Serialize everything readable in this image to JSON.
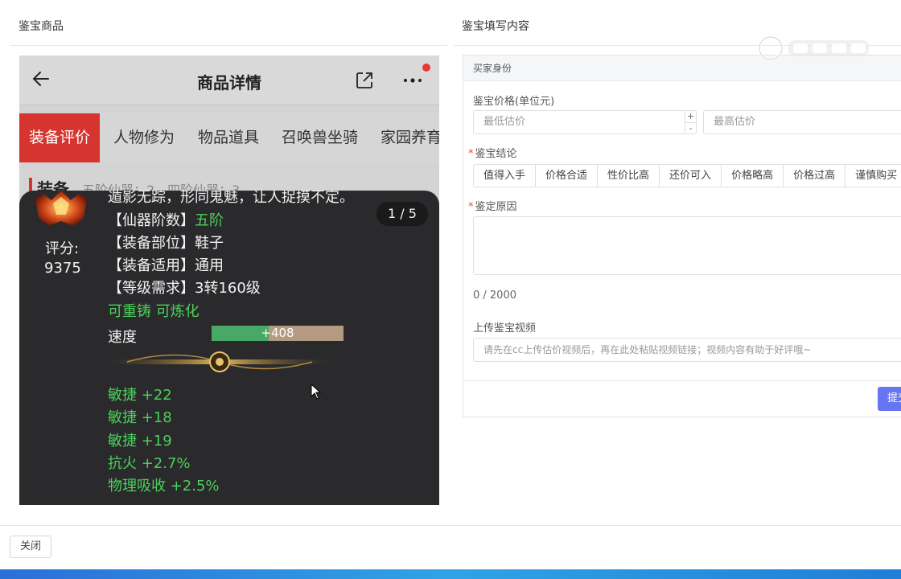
{
  "left_section": {
    "title": "鉴宝商品"
  },
  "right_section": {
    "title": "鉴宝填写内容"
  },
  "phone": {
    "header_title": "商品详情",
    "tabs": [
      "装备评价",
      "人物修为",
      "物品道具",
      "召唤兽坐骑",
      "家园养育"
    ],
    "subheading": "装备",
    "subheading_detail": "五阶仙器：2，四阶仙器：3",
    "overlay": {
      "score_label": "评分:",
      "score_value": "9375",
      "counter": "1 / 5",
      "intro_line": "遁影无踪，形同鬼魅，让人捉摸不定。",
      "rank_label": "【仙器阶数】",
      "rank_value": "五阶",
      "part_line": "【装备部位】鞋子",
      "use_line": "【装备适用】通用",
      "level_line": "【等级需求】3转160级",
      "recast_line": "可重铸 可炼化",
      "speed_label": "速度",
      "speed_value": "+408",
      "speed_fill": 0.43,
      "attrs": [
        "敏捷 +22",
        "敏捷 +18",
        "敏捷 +19",
        "抗火 +2.7%",
        "物理吸收 +2.5%"
      ]
    }
  },
  "form": {
    "buyer_identity_label": "买家身份",
    "price_label": "鉴宝价格(单位元)",
    "min_price_placeholder": "最低估价",
    "max_price_placeholder": "最高估价",
    "stepper_plus": "+",
    "stepper_minus": "-",
    "required_mark": "*",
    "conclusion_label": "鉴宝结论",
    "conclusion_options": [
      "值得入手",
      "价格合适",
      "性价比高",
      "还价可入",
      "价格略高",
      "价格过高",
      "谨慎购买"
    ],
    "reason_label": "鉴定原因",
    "reason_counter": "0 / 2000",
    "video_label": "上传鉴宝视频",
    "video_placeholder": "请先在cc上传估价视频后，再在此处粘贴视频链接；视频内容有助于好评哦~",
    "submit_label": "提交"
  },
  "footer": {
    "close_label": "关闭"
  },
  "colors": {
    "tab_active": "#d5352e",
    "attr_green": "#4bd05a",
    "submit_blue": "#6576f0"
  }
}
